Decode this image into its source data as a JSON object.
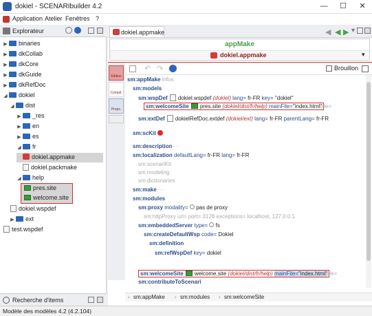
{
  "window": {
    "title": "dokiel - SCENARIbuilder 4.2",
    "minimize": "—",
    "maximize": "☐",
    "close": "✕"
  },
  "menu": [
    "Application",
    "Atelier",
    "Fenêtres",
    "?"
  ],
  "explorer": {
    "title": "Explorateur",
    "search_panel": "Recherche d'items",
    "items": [
      {
        "label": "binaries"
      },
      {
        "label": "dkCollab"
      },
      {
        "label": "dkCore"
      },
      {
        "label": "dkGuide"
      },
      {
        "label": "dkRefDoc"
      },
      {
        "label": "dokiel"
      },
      {
        "label": "dist"
      },
      {
        "label": "_res"
      },
      {
        "label": "en"
      },
      {
        "label": "es"
      },
      {
        "label": "fr"
      },
      {
        "label": "dokiel.appmake"
      },
      {
        "label": "dokiel.packmake"
      },
      {
        "label": "help"
      },
      {
        "label": "pres.site"
      },
      {
        "label": "welcome.site"
      },
      {
        "label": "dokiel.wspdef"
      },
      {
        "label": "ext"
      },
      {
        "label": "test.wspdef"
      }
    ]
  },
  "editor": {
    "tab": "dokiel.appmake",
    "model_title": "appMake",
    "model_file": "dokiel.appmake",
    "vtabs": [
      "Édition",
      "Compil.",
      "Props."
    ],
    "brouillon": "Brouillon",
    "lines": {
      "l1a": "sm:appMake",
      "l1b": "infos",
      "l2": "sm:models",
      "l3a": "sm:wspDef",
      "l3b": "dokiel.wspdef",
      "l3c": "(dokiel)",
      "l3d": "lang=",
      "l3e": "fr-FR",
      "l3f": "key=",
      "l3g": "\"dokiel\"",
      "l4a": "sm:welcomeSite",
      "l4b": "pres.site",
      "l4c": "(dokiel/dist/fr/help)",
      "l4d": "mainFile=",
      "l4e": "\"index.html\"",
      "l4f": "title=",
      "l5a": "sm:extDef",
      "l5b": "dokielRefDoc.extdef",
      "l5c": "(dokiel/ext)",
      "l5d": "lang=",
      "l5e": "fr-FR",
      "l5f": "parentLang=",
      "l5g": "fr-FR",
      "l6": "sm:scKit",
      "l7": "sm:description",
      "l8a": "sm:localization",
      "l8b": "defaultLang=",
      "l8c": "fr-FR",
      "l8d": "lang=",
      "l8e": "fr-FR",
      "l9": "sm:scenariKit",
      "l10": "sm:modeling",
      "l11": "sm:dictionaries",
      "l12": "sm:make",
      "l13": "sm:modules",
      "l14a": "sm:proxy",
      "l14b": "modality=",
      "l14c": "pas de proxy",
      "l15a": "sm:httpProxy",
      "l15b": "url=",
      "l15c": "port=",
      "l15d": "3128",
      "l15e": "exceptions=",
      "l15f": "localhost, 127.0.0.1",
      "l16a": "sm:embeddedServer",
      "l16b": "type=",
      "l16c": "fs",
      "l17a": "sm:createDefaultWsp",
      "l17b": "code=",
      "l17c": "Dokiel",
      "l18": "sm:definition",
      "l19a": "sm:refWspDef",
      "l19b": "key=",
      "l19c": "dokiel",
      "l20a": "sm:welcomeSite",
      "l20b": "welcome.site",
      "l20c": "(dokiel/dist/fr/help)",
      "l20d": "mainFile=",
      "l20e": "\"index.html\"",
      "l20f": "title=",
      "l21": "sm:contributeToScenari"
    },
    "breadcrumb": [
      "sm:appMake",
      "sm:modules",
      "sm:welcomeSite"
    ]
  },
  "status": "Modèle des modèles 4.2 (4.2.104)",
  "colors": {
    "accent": "#d03030",
    "title_green": "#4aa04a",
    "folder": "#2b66b9"
  }
}
